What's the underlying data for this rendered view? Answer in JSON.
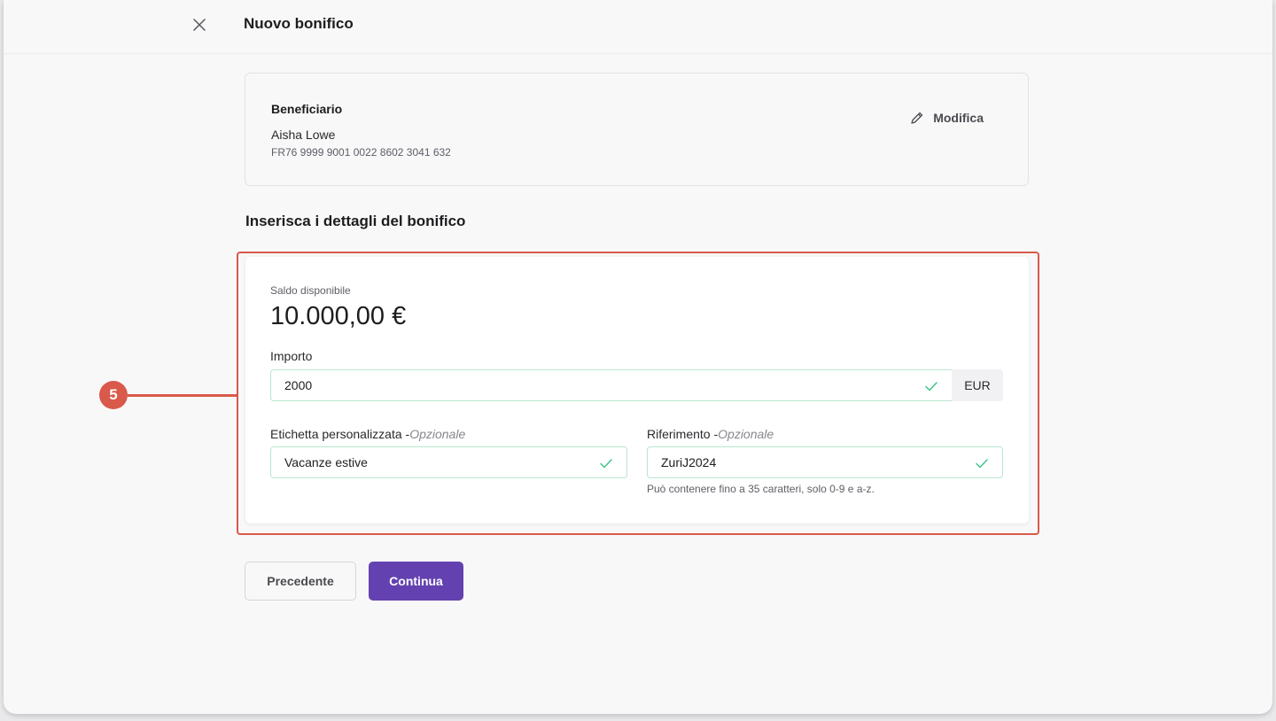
{
  "header": {
    "title": "Nuovo bonifico",
    "close_icon": "close-icon"
  },
  "beneficiary": {
    "label": "Beneficiario",
    "name": "Aisha Lowe",
    "iban": "FR76 9999 9001 0022 8602 3041 632",
    "edit_label": "Modifica",
    "edit_icon": "pencil-icon"
  },
  "section_title": "Inserisca i dettagli del bonifico",
  "details": {
    "balance_label": "Saldo disponibile",
    "balance_value": "10.000,00 €",
    "amount": {
      "label": "Importo",
      "value": "2000",
      "currency": "EUR"
    },
    "custom_label": {
      "label": "Etichetta personalizzata -",
      "optional": "Opzionale",
      "value": "Vacanze estive"
    },
    "reference": {
      "label": "Riferimento -",
      "optional": "Opzionale",
      "value": "ZuriJ2024",
      "hint": "Può contenere fino a 35 caratteri, solo 0-9 e a-z."
    }
  },
  "annotation": {
    "number": "5",
    "color": "#d9594a"
  },
  "buttons": {
    "previous": "Precedente",
    "continue": "Continua"
  },
  "colors": {
    "accent": "#6441b0",
    "valid": "#3fc48a",
    "annotation": "#d9594a"
  }
}
